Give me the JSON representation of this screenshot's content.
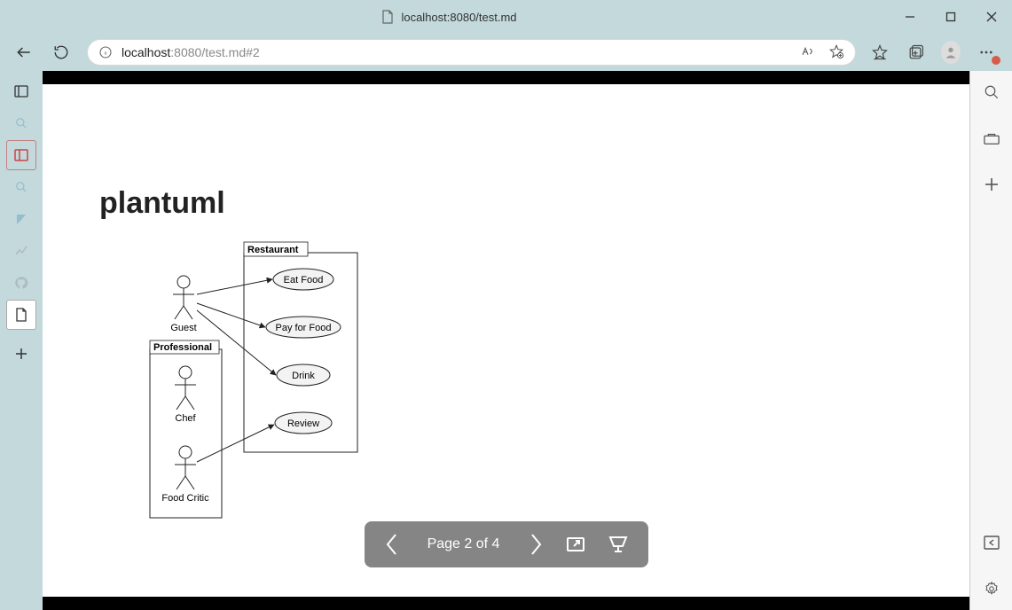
{
  "window": {
    "tab_title": "localhost:8080/test.md",
    "controls": {
      "minimize": "−",
      "maximize": "☐",
      "close": "✕"
    }
  },
  "addressbar": {
    "host": "localhost",
    "port": ":8080",
    "path": "/test.md#2"
  },
  "document": {
    "title": "plantuml"
  },
  "diagram": {
    "actors": [
      {
        "name": "Guest",
        "group": null
      },
      {
        "name": "Chef",
        "group": "Professional"
      },
      {
        "name": "Food Critic",
        "group": "Professional"
      }
    ],
    "system_label": "Restaurant",
    "group_label": "Professional",
    "usecases": [
      {
        "name": "Eat Food"
      },
      {
        "name": "Pay for Food"
      },
      {
        "name": "Drink"
      },
      {
        "name": "Review"
      }
    ],
    "associations": [
      {
        "from": "Guest",
        "to": "Eat Food"
      },
      {
        "from": "Guest",
        "to": "Pay for Food"
      },
      {
        "from": "Guest",
        "to": "Drink"
      },
      {
        "from": "Food Critic",
        "to": "Review"
      }
    ]
  },
  "pager": {
    "label": "Page 2 of 4"
  },
  "left_sidebar": {
    "items": [
      {
        "id": "sidebar-thumbs",
        "desc": "Toggle sidebar"
      },
      {
        "id": "sidebar-search",
        "desc": "Search"
      },
      {
        "id": "sidebar-slides",
        "desc": "Slide view"
      },
      {
        "id": "sidebar-find",
        "desc": "Find"
      },
      {
        "id": "sidebar-bookmark",
        "desc": "Bookmark"
      },
      {
        "id": "sidebar-stats",
        "desc": "Stats"
      },
      {
        "id": "sidebar-github",
        "desc": "GitHub"
      },
      {
        "id": "sidebar-file",
        "desc": "File (active)"
      }
    ]
  }
}
